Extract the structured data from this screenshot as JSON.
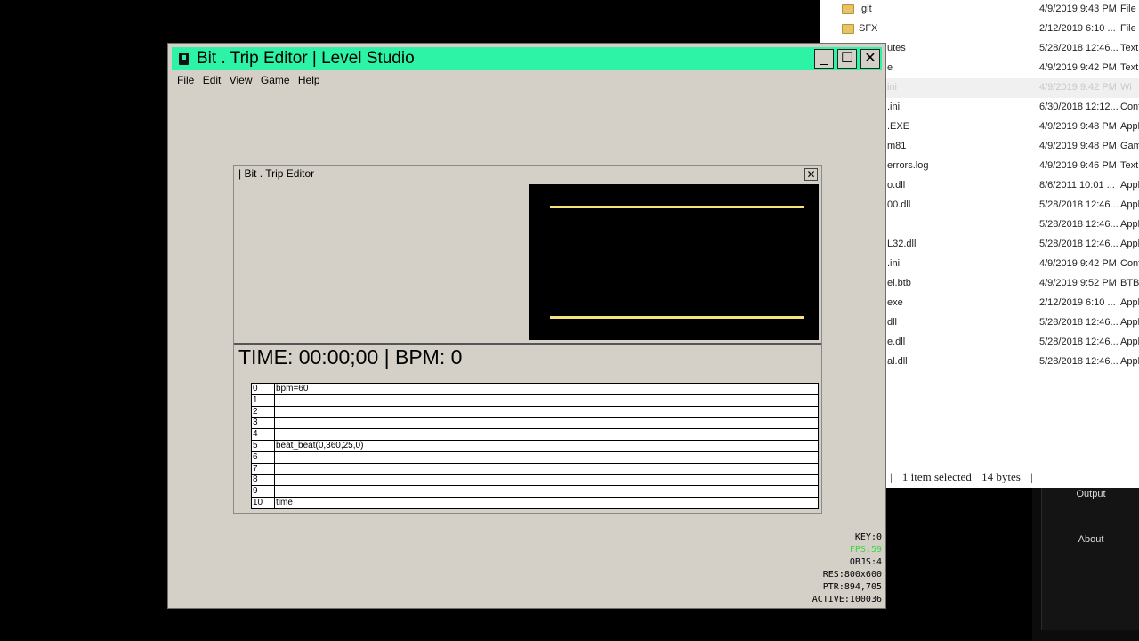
{
  "explorer": {
    "rows": [
      {
        "name": ".git",
        "date": "4/9/2019 9:43 PM",
        "type": "File f",
        "folder": true
      },
      {
        "name": "SFX",
        "date": "2/12/2019 6:10 ...",
        "type": "File f",
        "folder": true
      },
      {
        "name": "utes",
        "date": "5/28/2018 12:46...",
        "type": "Text"
      },
      {
        "name": "e",
        "date": "4/9/2019 9:42 PM",
        "type": "Text"
      },
      {
        "name": "ini",
        "date": "4/9/2019 9:42 PM",
        "type": "Wi",
        "selected": true
      },
      {
        "name": ".ini",
        "date": "6/30/2018 12:12...",
        "type": "Confi"
      },
      {
        "name": ".EXE",
        "date": "4/9/2019 9:48 PM",
        "type": "Appli"
      },
      {
        "name": "m81",
        "date": "4/9/2019 9:48 PM",
        "type": "Gam"
      },
      {
        "name": "errors.log",
        "date": "4/9/2019 9:46 PM",
        "type": "Text"
      },
      {
        "name": "o.dll",
        "date": "8/6/2011 10:01 ...",
        "type": "Appli"
      },
      {
        "name": "00.dll",
        "date": "5/28/2018 12:46...",
        "type": "Appli"
      },
      {
        "name": "",
        "date": "5/28/2018 12:46...",
        "type": "Appli"
      },
      {
        "name": "L32.dll",
        "date": "5/28/2018 12:46...",
        "type": "Appli"
      },
      {
        "name": ".ini",
        "date": "4/9/2019 9:42 PM",
        "type": "Confi"
      },
      {
        "name": "el.btb",
        "date": "4/9/2019 9:52 PM",
        "type": "BTB"
      },
      {
        "name": "exe",
        "date": "2/12/2019 6:10 ...",
        "type": "Appli"
      },
      {
        "name": "dll",
        "date": "5/28/2018 12:46...",
        "type": "Appli"
      },
      {
        "name": "e.dll",
        "date": "5/28/2018 12:46...",
        "type": "Appli"
      },
      {
        "name": "al.dll",
        "date": "5/28/2018 12:46...",
        "type": "Appli"
      }
    ],
    "status": {
      "selected": "1 item selected",
      "size": "14 bytes"
    }
  },
  "side_panel": {
    "output_label": "Output",
    "about_label": "About"
  },
  "window": {
    "title": "Bit . Trip Editor | Level Studio",
    "minimize": "_",
    "maximize": "☐",
    "close": "✕",
    "menu": [
      "File",
      "Edit",
      "View",
      "Game",
      "Help"
    ]
  },
  "editor": {
    "title": "| Bit . Trip Editor",
    "close": "✕",
    "timeline": "TIME: 00:00;00 | BPM: 0",
    "lane_color": "#f4e27a",
    "rows": [
      {
        "index": "0",
        "cmd": "bpm=60"
      },
      {
        "index": "1",
        "cmd": ""
      },
      {
        "index": "2",
        "cmd": ""
      },
      {
        "index": "3",
        "cmd": ""
      },
      {
        "index": "4",
        "cmd": ""
      },
      {
        "index": "5",
        "cmd": "beat_beat(0,360,25,0)"
      },
      {
        "index": "6",
        "cmd": ""
      },
      {
        "index": "7",
        "cmd": ""
      },
      {
        "index": "8",
        "cmd": ""
      },
      {
        "index": "9",
        "cmd": ""
      },
      {
        "index": "10",
        "cmd": "time"
      }
    ]
  },
  "debug": {
    "key": "KEY:0",
    "fps": "FPS:59",
    "objs": "OBJS:4",
    "res": "RES:800x600",
    "ptr": "PTR:894,705",
    "active": "ACTIVE:100036"
  },
  "colors": {
    "titlebar": "#2df3a6",
    "fps": "#39d939",
    "window_bg": "#d4d0c8"
  }
}
